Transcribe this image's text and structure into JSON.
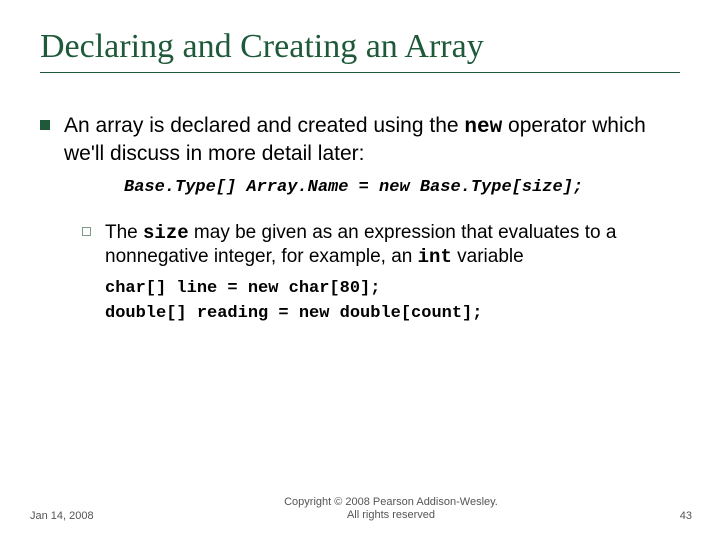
{
  "title": "Declaring and Creating an Array",
  "main": {
    "text_part1": "An array is declared and created using the ",
    "mono1": "new",
    "text_part2": " operator which we'll discuss in more detail later:",
    "syntax": "Base.Type[] Array.Name = new Base.Type[size];"
  },
  "sub": {
    "text_a": "The ",
    "mono_a": "size",
    "text_b": " may be given as an expression that evaluates to a nonnegative integer, for example, an ",
    "mono_b": "int",
    "text_c": " variable",
    "code1": "char[] line = new char[80];",
    "code2": "double[] reading = new double[count];"
  },
  "footer": {
    "date": "Jan 14, 2008",
    "copyright_line1": "Copyright © 2008 Pearson Addison-Wesley.",
    "copyright_line2": "All rights reserved",
    "page": "43"
  }
}
